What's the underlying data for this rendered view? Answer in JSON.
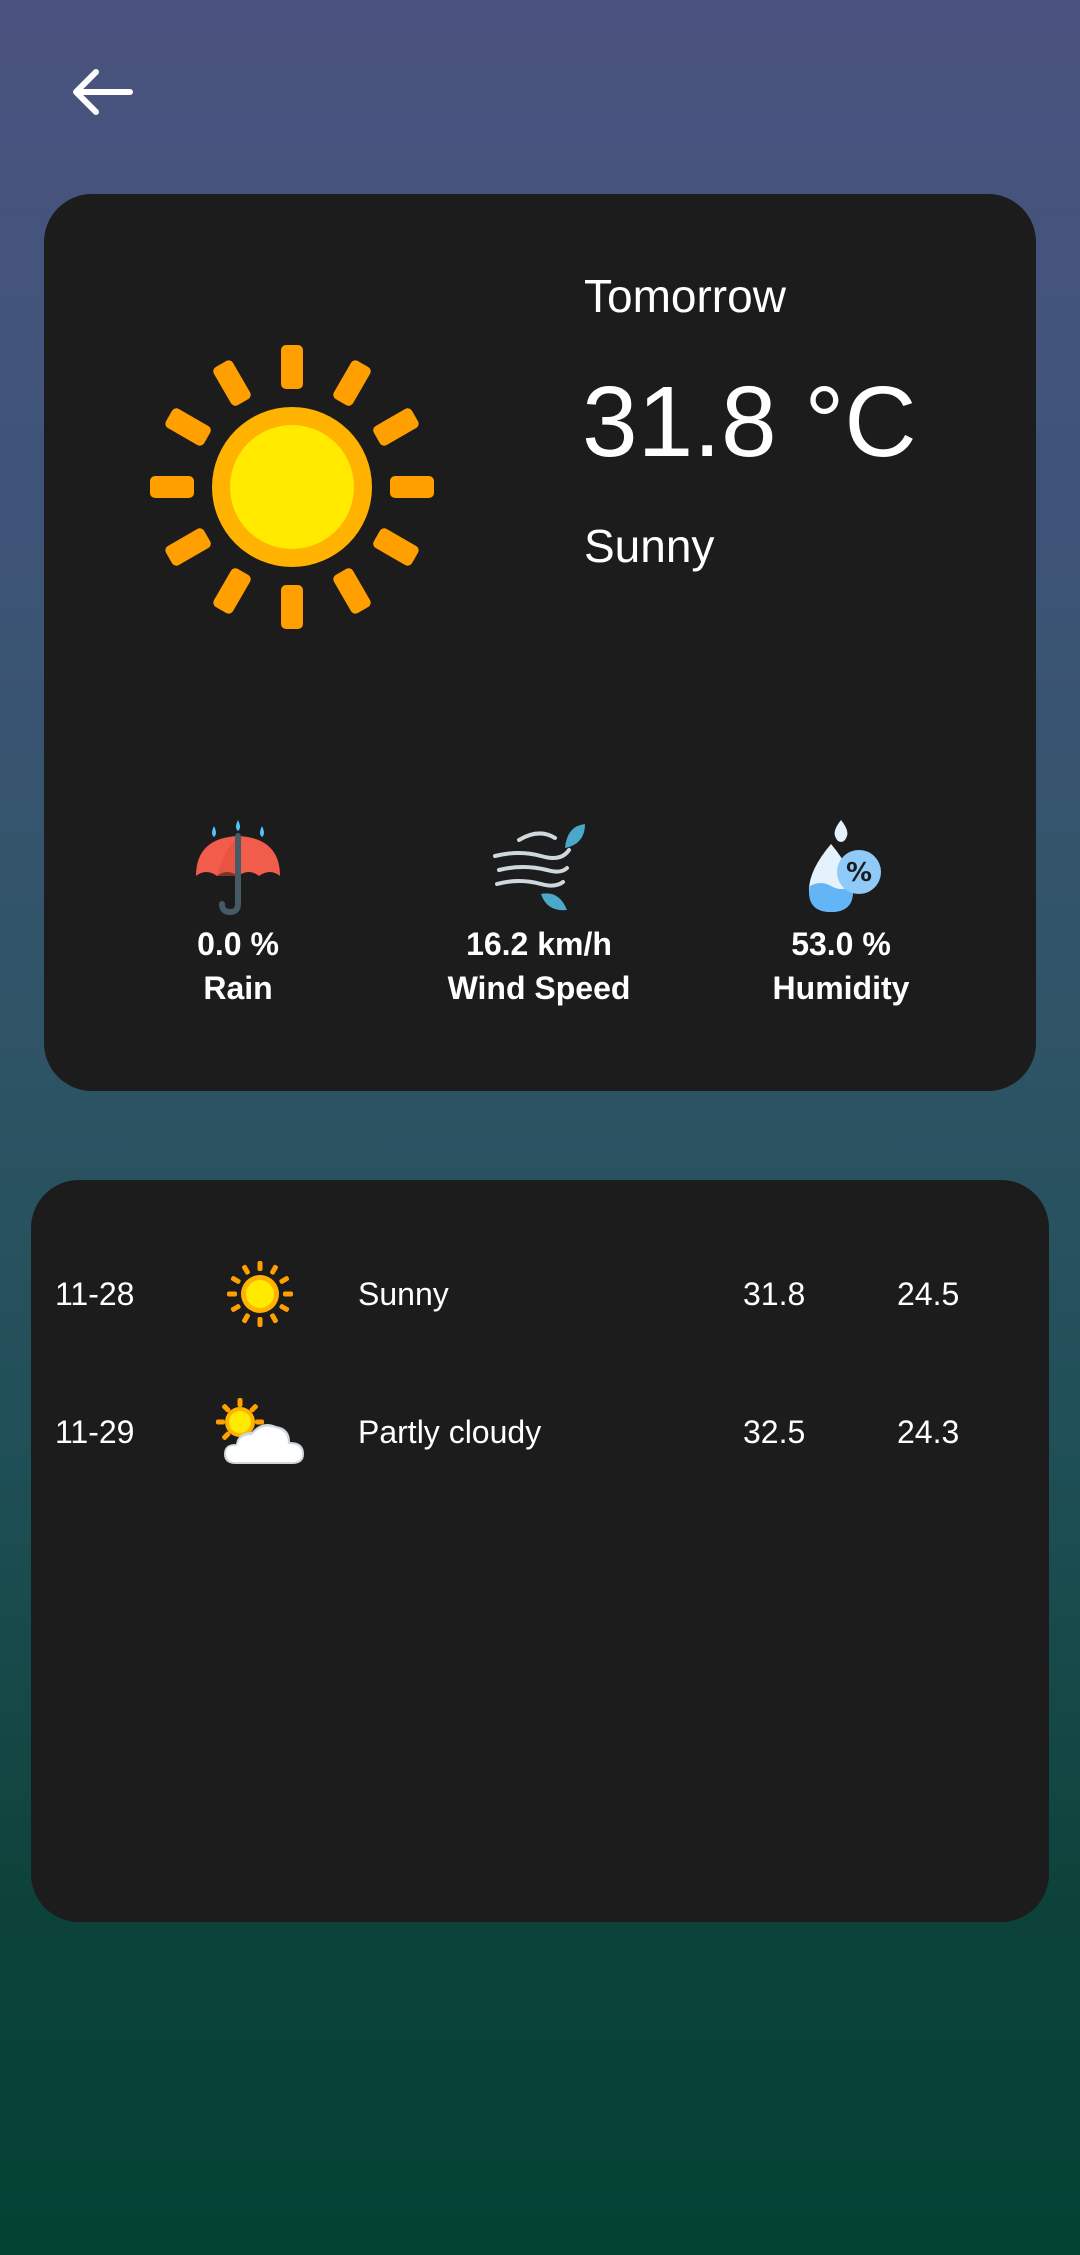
{
  "navigation": {
    "back_icon": "arrow-left-icon"
  },
  "current": {
    "day": "Tomorrow",
    "temperature": "31.8 °C",
    "condition": "Sunny",
    "icon": "sun-icon"
  },
  "stats": [
    {
      "value": "0.0 %",
      "label": "Rain",
      "icon": "umbrella-rain-icon"
    },
    {
      "value": "16.2 km/h",
      "label": "Wind Speed",
      "icon": "wind-icon"
    },
    {
      "value": "53.0 %",
      "label": "Humidity",
      "icon": "humidity-drop-icon"
    }
  ],
  "forecast": [
    {
      "date": "11-28",
      "condition": "Sunny",
      "high": "31.8",
      "low": "24.5",
      "icon": "sun-icon"
    },
    {
      "date": "11-29",
      "condition": "Partly cloudy",
      "high": "32.5",
      "low": "24.3",
      "icon": "partly-cloudy-icon"
    }
  ],
  "colors": {
    "card_background": "#1c1c1c",
    "gradient_top": "#4a537f",
    "gradient_bottom": "#034334",
    "sun": "#ffc107",
    "text": "#ffffff"
  }
}
